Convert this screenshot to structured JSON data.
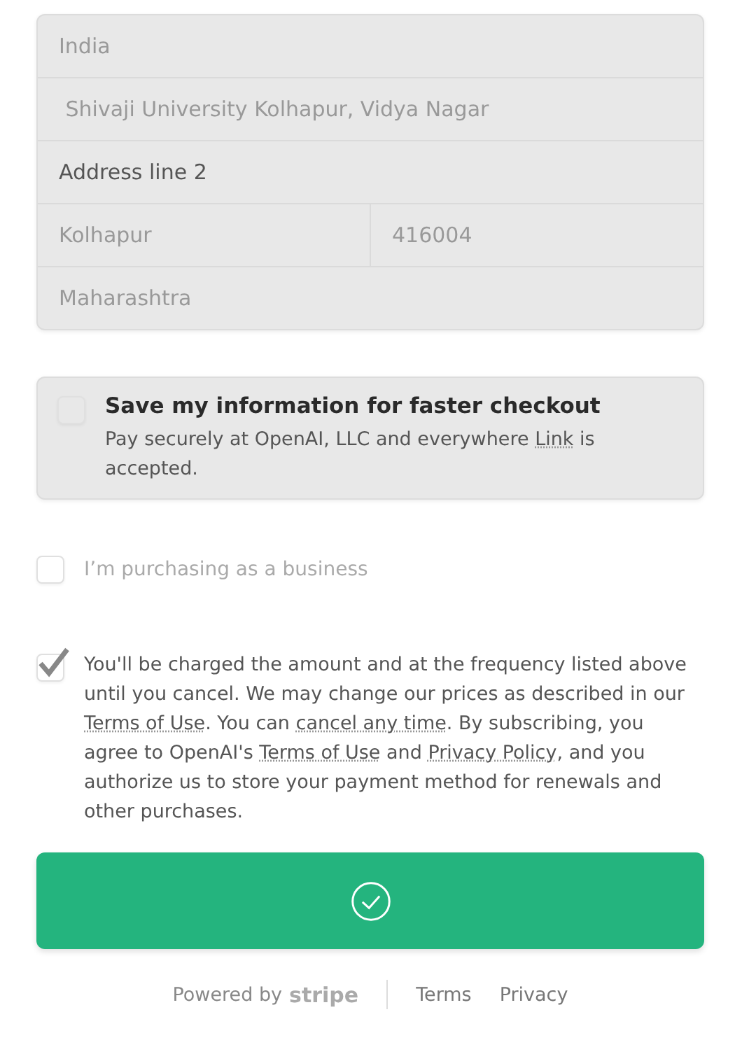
{
  "address_fields": [
    {
      "row": [
        {
          "value": "India",
          "disabled": true
        }
      ]
    },
    {
      "row": [
        {
          "value": " Shivaji University Kolhapur, Vidya Nagar",
          "disabled": true
        }
      ]
    },
    {
      "row": [
        {
          "placeholder": "Address line 2",
          "disabled": false
        }
      ]
    },
    {
      "row": [
        {
          "value": "Kolhapur",
          "disabled": true
        },
        {
          "value": "416004",
          "disabled": true
        }
      ]
    },
    {
      "row": [
        {
          "value": "Maharashtra",
          "disabled": true
        }
      ]
    }
  ],
  "save_info": {
    "checked": false,
    "title": "Save my information for faster checkout",
    "description": [
      {
        "text": "Pay securely at OpenAI, LLC and everywhere ",
        "link": false
      },
      {
        "text": "Link",
        "link": true
      },
      {
        "text": " is accepted.",
        "link": false
      }
    ]
  },
  "business": {
    "checked": false,
    "disabled": true,
    "label": "I’m purchasing as a business"
  },
  "terms": {
    "checked": true,
    "segments": [
      {
        "text": "You'll be charged the amount and at the frequency listed above until you cancel. We may change our prices as described in our ",
        "link": false
      },
      {
        "text": "Terms of Use",
        "link": true
      },
      {
        "text": ". You can ",
        "link": false
      },
      {
        "text": "cancel any time",
        "link": true
      },
      {
        "text": ". By subscribing, you agree to OpenAI's ",
        "link": false
      },
      {
        "text": "Terms of Use",
        "link": true
      },
      {
        "text": " and ",
        "link": false
      },
      {
        "text": "Privacy Policy",
        "link": true
      },
      {
        "text": ", and you authorize us to store your payment method for renewals and other purchases.",
        "link": false
      }
    ]
  },
  "submit": {
    "done": true
  },
  "footer": {
    "powered_by": "Powered by",
    "brand": "stripe",
    "links": [
      "Terms",
      "Privacy"
    ]
  }
}
